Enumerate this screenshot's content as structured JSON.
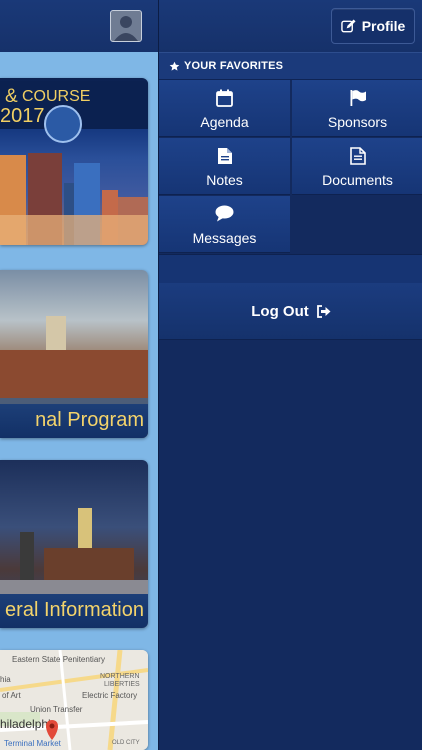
{
  "left_panel": {
    "tiles": [
      {
        "caption": "",
        "title_amp": "&",
        "title_course": "COURSE",
        "title_year": "2017"
      },
      {
        "caption": "nal Program"
      },
      {
        "caption": "eral Information"
      },
      {
        "map_labels": [
          "Eastern State Penitentiary",
          "NORTHERN",
          "LIBERTIES",
          "hia",
          "of Art",
          "Electric Factory",
          "Union Transfer",
          "hiladelphia",
          "Terminal Market",
          "OLD CITY"
        ]
      }
    ]
  },
  "header": {
    "profile_label": "Profile",
    "profile_icon": "edit-icon"
  },
  "favorites": {
    "title": "YOUR FAVORITES",
    "title_icon": "star-icon",
    "items": [
      {
        "label": "Agenda",
        "icon": "calendar-icon"
      },
      {
        "label": "Sponsors",
        "icon": "flag-icon"
      },
      {
        "label": "Notes",
        "icon": "document-icon"
      },
      {
        "label": "Documents",
        "icon": "document-lines-icon"
      },
      {
        "label": "Messages",
        "icon": "comment-icon"
      }
    ]
  },
  "logout": {
    "label": "Log Out",
    "icon": "sign-out-icon"
  },
  "colors": {
    "header_bg": "#1a3978",
    "drawer_bg": "#132a5e",
    "tile_bg": "#1e428a",
    "accent_gold": "#f1cf63",
    "left_bg": "#7fb7e6"
  }
}
